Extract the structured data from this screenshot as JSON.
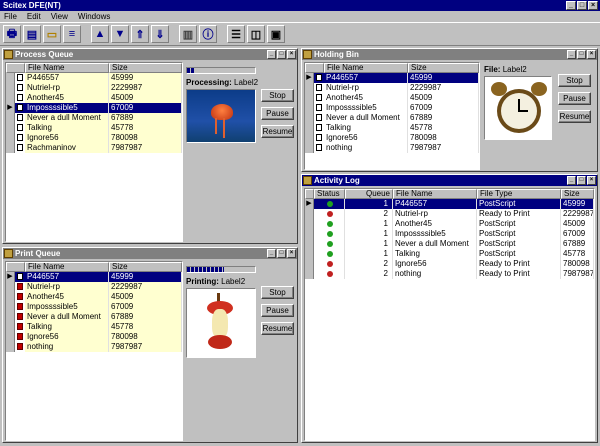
{
  "app": {
    "title": "Scitex DFE(NT)"
  },
  "menu": [
    "File",
    "Edit",
    "View",
    "Windows"
  ],
  "toolbar_icons": [
    "print-icon",
    "queue-icon",
    "folder-icon",
    "stack-icon",
    "up-icon",
    "down-icon",
    "top-icon",
    "bottom-icon",
    "trash-icon",
    "info-icon",
    "layout1-icon",
    "layout2-icon",
    "layout3-icon"
  ],
  "process_queue": {
    "title": "Process Queue",
    "columns": [
      "File Name",
      "Size"
    ],
    "rows": [
      {
        "name": "P446557",
        "size": "45999"
      },
      {
        "name": "Nutriel-rp",
        "size": "2229987"
      },
      {
        "name": "Another45",
        "size": "45009"
      },
      {
        "name": "Impossssible5",
        "size": "67009"
      },
      {
        "name": "Never a dull Moment",
        "size": "67889"
      },
      {
        "name": "Talking",
        "size": "45778"
      },
      {
        "name": "Ignore56",
        "size": "780098"
      },
      {
        "name": "Rachmaninov",
        "size": "7987987"
      }
    ],
    "selected_index": 3,
    "status_label": "Processing:",
    "status_value": "Label2",
    "progress": 0.1,
    "buttons": [
      "Stop",
      "Pause",
      "Resume"
    ]
  },
  "holding_bin": {
    "title": "Holding Bin",
    "columns": [
      "File Name",
      "Size"
    ],
    "rows": [
      {
        "name": "P446557",
        "size": "45999"
      },
      {
        "name": "Nutriel-rp",
        "size": "2229987"
      },
      {
        "name": "Another45",
        "size": "45009"
      },
      {
        "name": "Impossssible5",
        "size": "67009"
      },
      {
        "name": "Never a dull Moment",
        "size": "67889"
      },
      {
        "name": "Talking",
        "size": "45778"
      },
      {
        "name": "Ignore56",
        "size": "780098"
      },
      {
        "name": "nothing",
        "size": "7987987"
      }
    ],
    "selected_index": 0,
    "file_label": "File:",
    "file_value": "Label2",
    "buttons": [
      "Stop",
      "Pause",
      "Resume"
    ]
  },
  "print_queue": {
    "title": "Print Queue",
    "columns": [
      "File Name",
      "Size"
    ],
    "rows": [
      {
        "name": "P446557",
        "size": "45999"
      },
      {
        "name": "Nutriel-rp",
        "size": "2229987"
      },
      {
        "name": "Another45",
        "size": "45009"
      },
      {
        "name": "Impossssible5",
        "size": "67009"
      },
      {
        "name": "Never a dull Moment",
        "size": "67889"
      },
      {
        "name": "Talking",
        "size": "45778"
      },
      {
        "name": "Ignore56",
        "size": "780098"
      },
      {
        "name": "nothing",
        "size": "7987987"
      }
    ],
    "selected_index": 0,
    "status_label": "Printing:",
    "status_value": "Label2",
    "progress": 0.55,
    "buttons": [
      "Stop",
      "Pause",
      "Resume"
    ]
  },
  "activity_log": {
    "title": "Activity Log",
    "columns": [
      "Status",
      "Queue",
      "File Name",
      "File Type",
      "Size"
    ],
    "rows": [
      {
        "status": "green",
        "queue": "1",
        "name": "P446557",
        "type": "PostScript",
        "size": "45999"
      },
      {
        "status": "red",
        "queue": "2",
        "name": "Nutriel-rp",
        "type": "Ready to Print",
        "size": "2229987"
      },
      {
        "status": "green",
        "queue": "1",
        "name": "Another45",
        "type": "PostScript",
        "size": "45009"
      },
      {
        "status": "green",
        "queue": "1",
        "name": "Impossssible5",
        "type": "PostScript",
        "size": "67009"
      },
      {
        "status": "green",
        "queue": "1",
        "name": "Never a dull Moment",
        "type": "PostScript",
        "size": "67889"
      },
      {
        "status": "green",
        "queue": "1",
        "name": "Talking",
        "type": "PostScript",
        "size": "45778"
      },
      {
        "status": "red",
        "queue": "2",
        "name": "Ignore56",
        "type": "Ready to Print",
        "size": "780098"
      },
      {
        "status": "red",
        "queue": "2",
        "name": "nothing",
        "type": "Ready to Print",
        "size": "7987987"
      }
    ],
    "selected_index": 0
  },
  "colors": {
    "title_active": "#000080",
    "title_inactive": "#808080",
    "row_highlight": "#ffffd0",
    "selection": "#000080",
    "status_green": "#20a020",
    "status_red": "#c02020"
  }
}
